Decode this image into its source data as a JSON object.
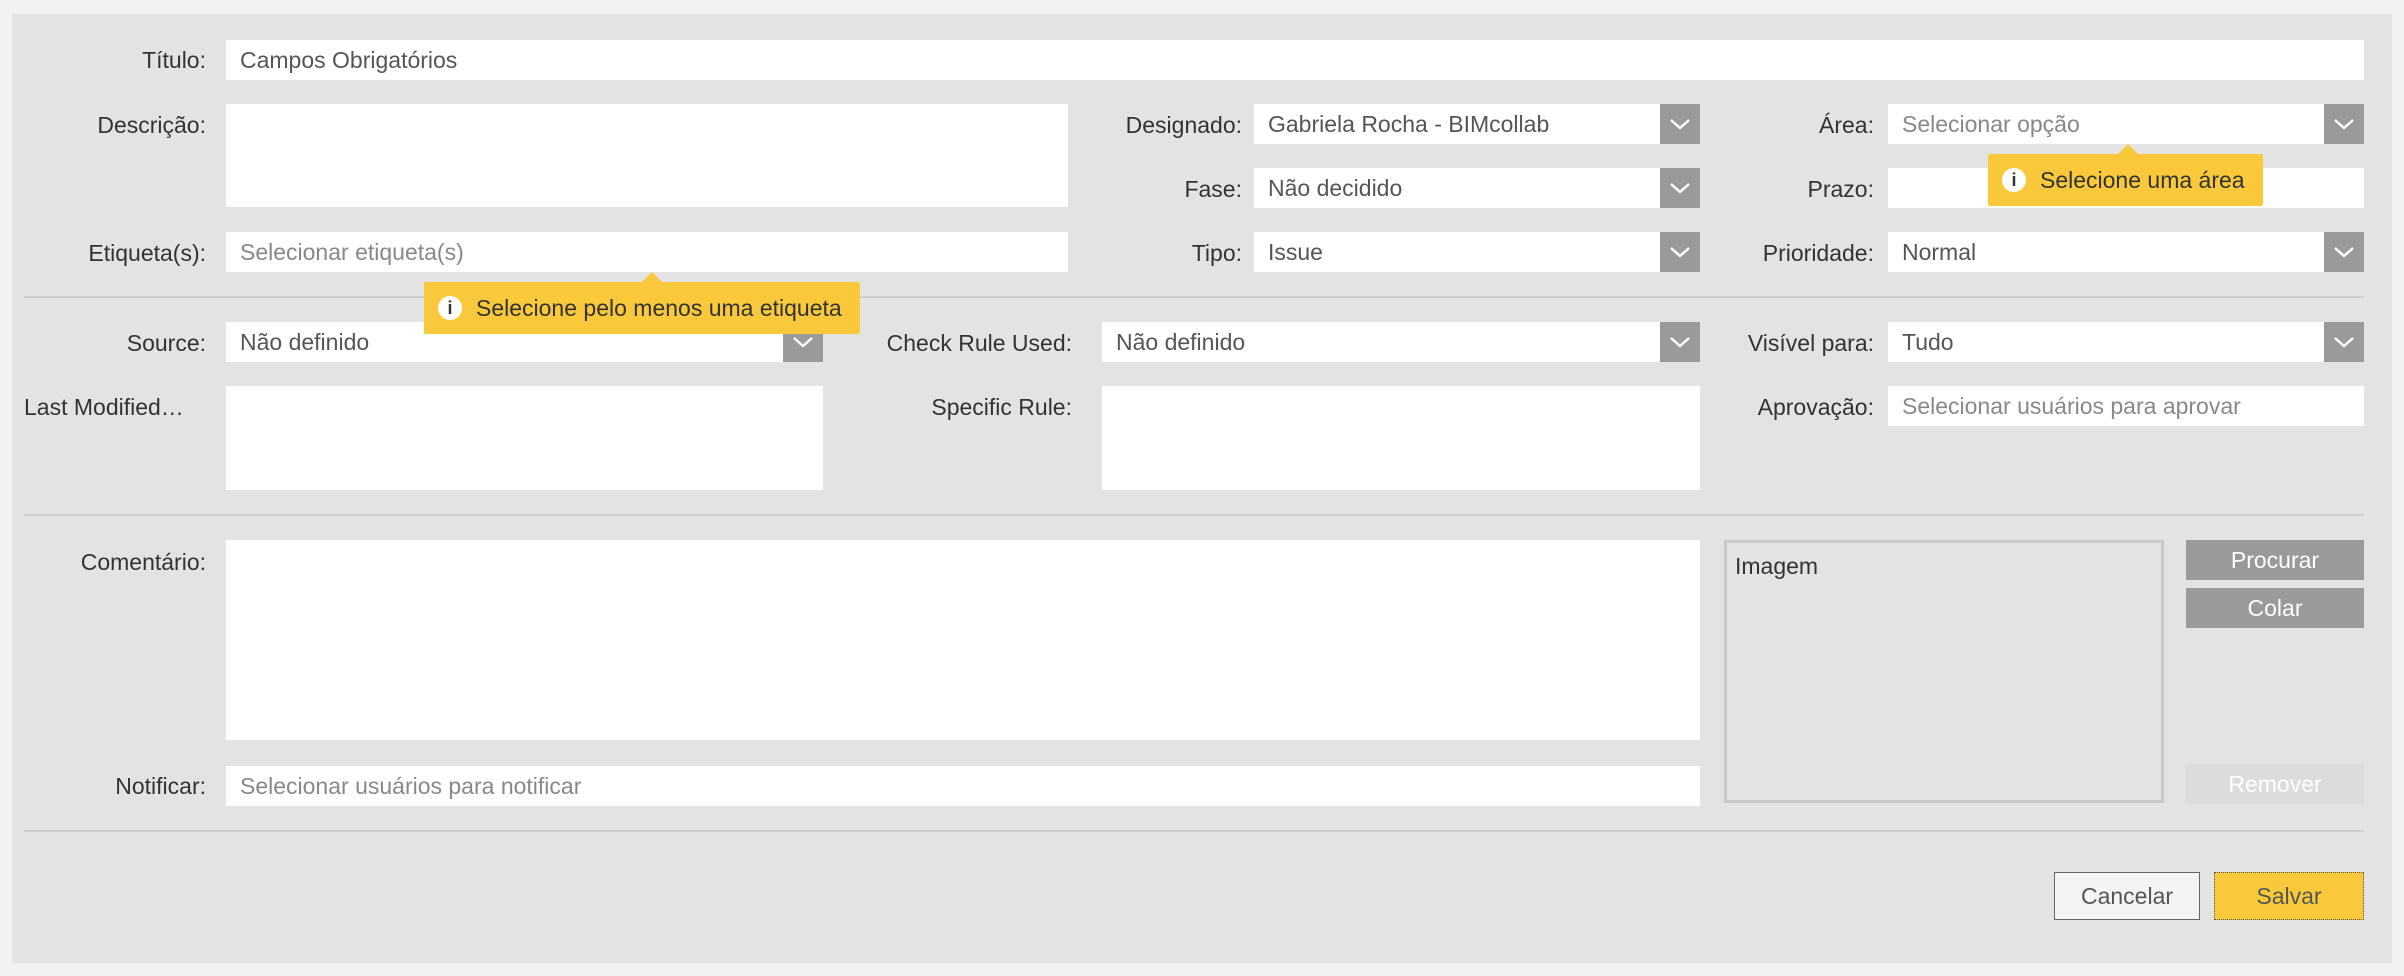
{
  "form": {
    "title_label": "Título:",
    "title_value": "Campos Obrigatórios",
    "description_label": "Descrição:",
    "assigned_label": "Designado:",
    "assigned_value": "Gabriela Rocha - BIMcollab",
    "area_label": "Área:",
    "area_placeholder": "Selecionar opção",
    "area_tooltip": "Selecione uma área",
    "phase_label": "Fase:",
    "phase_value": "Não decidido",
    "deadline_label": "Prazo:",
    "tags_label": "Etiqueta(s):",
    "tags_placeholder": "Selecionar etiqueta(s)",
    "tags_tooltip": "Selecione pelo menos uma etiqueta",
    "type_label": "Tipo:",
    "type_value": "Issue",
    "priority_label": "Prioridade:",
    "priority_value": "Normal",
    "source_label": "Source:",
    "source_value": "Não definido",
    "check_rule_label": "Check Rule Used:",
    "check_rule_value": "Não definido",
    "visible_label": "Visível para:",
    "visible_value": "Tudo",
    "last_modified_label": "Last Modified…",
    "specific_rule_label": "Specific Rule:",
    "approval_label": "Aprovação:",
    "approval_placeholder": "Selecionar usuários para aprovar",
    "comment_label": "Comentário:",
    "image_label": "Imagem",
    "browse_button": "Procurar",
    "paste_button": "Colar",
    "remove_button": "Remover",
    "notify_label": "Notificar:",
    "notify_placeholder": "Selecionar usuários para notificar",
    "cancel_button": "Cancelar",
    "save_button": "Salvar"
  },
  "icons": {
    "dropdown": "chevron-down-icon",
    "info": "info-icon"
  },
  "colors": {
    "tooltip": "#f9c93b",
    "save_button": "#f9c93b",
    "dropdown_arrow_bg": "#9a9a9a",
    "panel_bg": "#e4e3e4"
  }
}
